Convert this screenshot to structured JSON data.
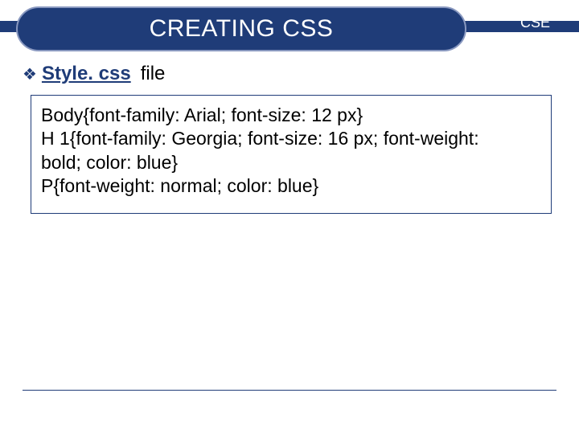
{
  "header": {
    "title": "CREATING CSS",
    "corner": "CSE"
  },
  "sub": {
    "bullet": "❖",
    "link": "Style. css",
    "rest": "file"
  },
  "code": {
    "l1": "Body{font-family: Arial; font-size: 12 px}",
    "l2": "H 1{font-family: Georgia; font-size: 16 px; font-weight:",
    "l3": "bold; color: blue}",
    "l4": "P{font-weight: normal; color: blue}"
  }
}
